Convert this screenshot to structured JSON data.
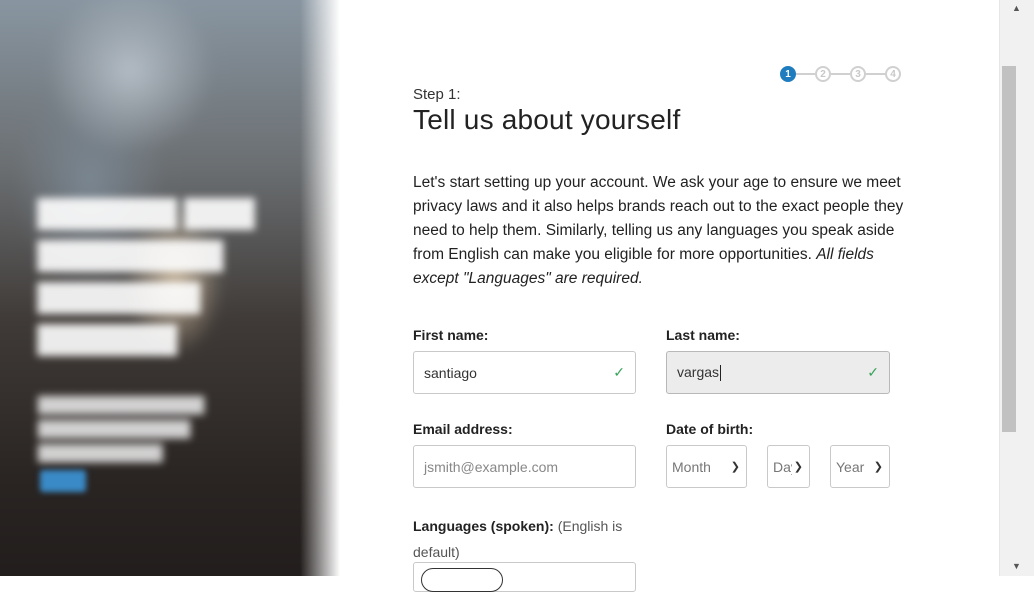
{
  "stepper": {
    "steps": [
      "1",
      "2",
      "3",
      "4"
    ],
    "current": "1"
  },
  "header": {
    "step_label": "Step 1:",
    "title": "Tell us about yourself"
  },
  "intro": {
    "text": "Let's start setting up your account. We ask your age to ensure we meet privacy laws and it also helps brands reach out to the exact people they need to help them. Similarly, telling us any languages you speak aside from English can make you eligible for more opportunities.",
    "note": "All fields except \"Languages\" are required."
  },
  "form": {
    "first_name": {
      "label": "First name:",
      "value": "santiago"
    },
    "last_name": {
      "label": "Last name:",
      "value": "vargas"
    },
    "email": {
      "label": "Email address:",
      "placeholder": "jsmith@example.com"
    },
    "dob": {
      "label": "Date of birth:",
      "month": "Month",
      "day": "Day",
      "year": "Year"
    },
    "languages": {
      "label": "Languages (spoken):",
      "hint": "(English is default)"
    }
  }
}
